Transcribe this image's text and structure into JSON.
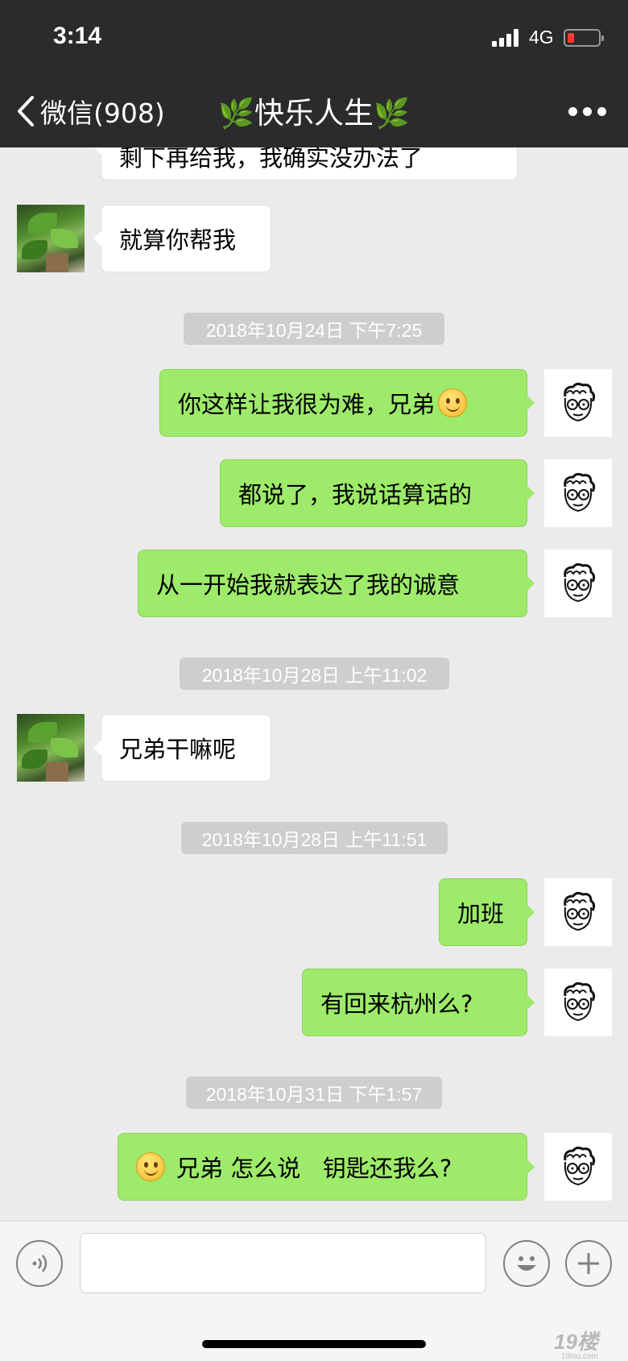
{
  "status_bar": {
    "time": "3:14",
    "network": "4G"
  },
  "nav": {
    "back_label": "微信(908)",
    "title_leaf_left": "🌿",
    "title": "快乐人生",
    "title_leaf_right": "🌿"
  },
  "messages": {
    "m0_partial": "剩下再给我，我确实没办法了",
    "m1": "就算你帮我",
    "ts1": "2018年10月24日 下午7:25",
    "m2": "你这样让我很为难，兄弟",
    "m3": "都说了，我说话算话的",
    "m4": "从一开始我就表达了我的诚意",
    "ts2": "2018年10月28日 上午11:02",
    "m5": "兄弟干嘛呢",
    "ts3": "2018年10月28日 上午11:51",
    "m6": "加班",
    "m7": "有回来杭州么?",
    "ts4": "2018年10月31日 下午1:57",
    "m8": "兄弟 怎么说   钥匙还我么?"
  },
  "watermark": {
    "main": "19楼",
    "sub": "19lou.com"
  },
  "colors": {
    "header_bg": "#2b2b2d",
    "chat_bg": "#ebebeb",
    "outgoing_bubble": "#9eea6a",
    "incoming_bubble": "#ffffff",
    "timestamp_bg": "#cecece"
  },
  "icons": {
    "back": "chevron-left-icon",
    "more": "more-dots-icon",
    "voice": "voice-icon",
    "emoji": "emoji-icon",
    "add": "plus-icon",
    "smiley": "smiley-emoji-icon"
  }
}
